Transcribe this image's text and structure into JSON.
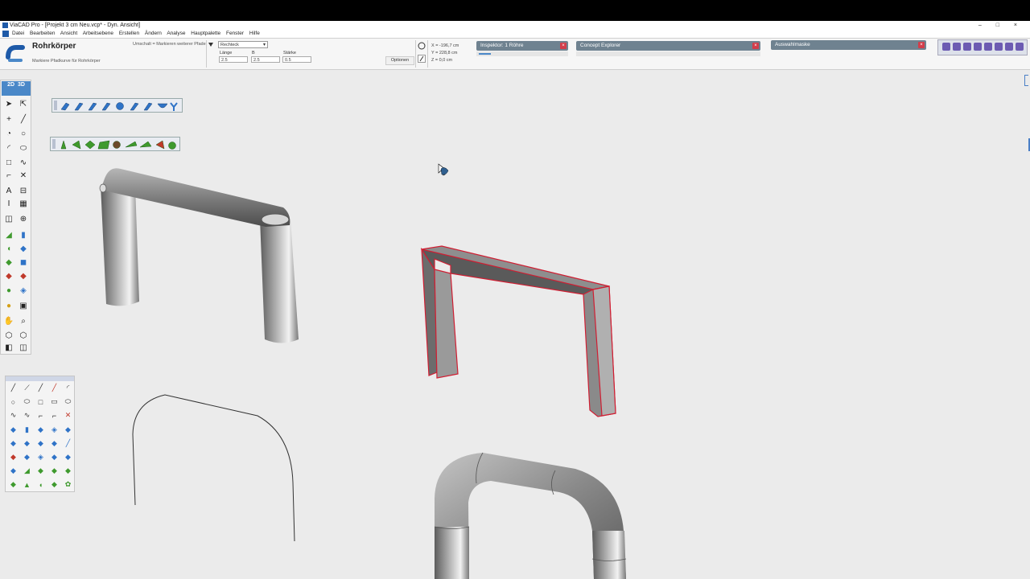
{
  "window": {
    "title": "ViaCAD Pro - [Projekt 3 cm Neu.vcp* - Dyn. Ansicht]",
    "controls": "–  □  ×"
  },
  "menu": [
    "Datei",
    "Bearbeiten",
    "Ansicht",
    "Arbeitsebene",
    "Erstellen",
    "Ändern",
    "Analyse",
    "Hauptpalette",
    "Fenster",
    "Hilfe"
  ],
  "tool": {
    "name": "Rohrkörper",
    "hint": "Markiere Pfadkurve für Rohrkörper",
    "mode_hint": "Umschalt = Markieren weiterer Pfade",
    "shape": "Rechteck",
    "length_label": "Länge",
    "length_value": "2.5",
    "b_label": "B",
    "b_value": "2.5",
    "thickness_label": "Stärke",
    "thickness_value": "0.5",
    "options_label": "Optionen"
  },
  "coords": {
    "x": "X = -196,7 cm",
    "y": "Y = 228,8 cm",
    "z": "Z = 0,0 cm"
  },
  "panels": {
    "inspector": "Inspektor: 1 Röhre",
    "explorer": "Concept Explorer",
    "selection": "Auswahlmaske"
  },
  "toolbar_left": {
    "mode_2d": "2D",
    "mode_3d": "3D"
  },
  "colors": {
    "selection_red": "#d01e32",
    "panel_header": "#6f8290",
    "accent_blue": "#1e5aa8",
    "tube_gray": "#8a8a8a",
    "palette_green": "#3f9a2e",
    "palette_blue": "#2f73c7"
  },
  "icons": {
    "tool": "tube-tool-icon",
    "close": "close-icon",
    "cursor": "mouse-pointer-icon"
  }
}
